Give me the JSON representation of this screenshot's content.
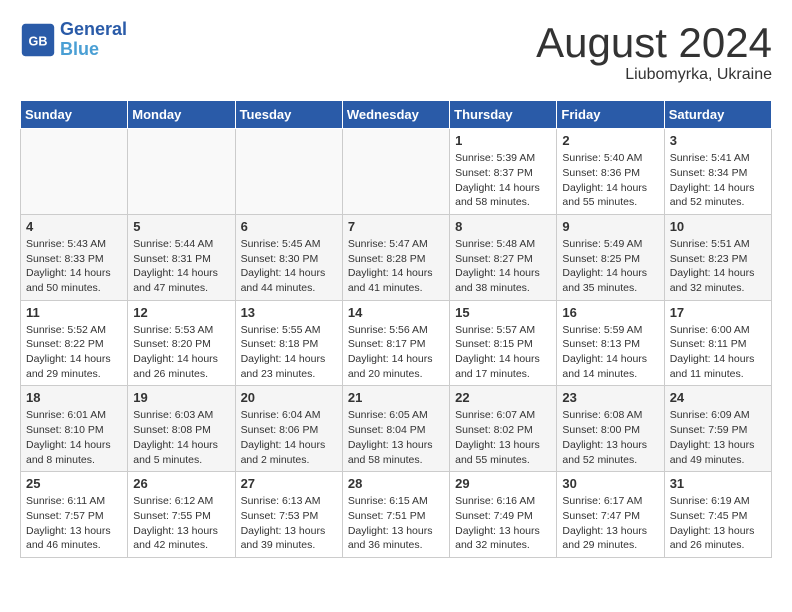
{
  "header": {
    "logo_line1": "General",
    "logo_line2": "Blue",
    "month": "August 2024",
    "location": "Liubomyrka, Ukraine"
  },
  "weekdays": [
    "Sunday",
    "Monday",
    "Tuesday",
    "Wednesday",
    "Thursday",
    "Friday",
    "Saturday"
  ],
  "weeks": [
    [
      {
        "day": "",
        "info": ""
      },
      {
        "day": "",
        "info": ""
      },
      {
        "day": "",
        "info": ""
      },
      {
        "day": "",
        "info": ""
      },
      {
        "day": "1",
        "info": "Sunrise: 5:39 AM\nSunset: 8:37 PM\nDaylight: 14 hours\nand 58 minutes."
      },
      {
        "day": "2",
        "info": "Sunrise: 5:40 AM\nSunset: 8:36 PM\nDaylight: 14 hours\nand 55 minutes."
      },
      {
        "day": "3",
        "info": "Sunrise: 5:41 AM\nSunset: 8:34 PM\nDaylight: 14 hours\nand 52 minutes."
      }
    ],
    [
      {
        "day": "4",
        "info": "Sunrise: 5:43 AM\nSunset: 8:33 PM\nDaylight: 14 hours\nand 50 minutes."
      },
      {
        "day": "5",
        "info": "Sunrise: 5:44 AM\nSunset: 8:31 PM\nDaylight: 14 hours\nand 47 minutes."
      },
      {
        "day": "6",
        "info": "Sunrise: 5:45 AM\nSunset: 8:30 PM\nDaylight: 14 hours\nand 44 minutes."
      },
      {
        "day": "7",
        "info": "Sunrise: 5:47 AM\nSunset: 8:28 PM\nDaylight: 14 hours\nand 41 minutes."
      },
      {
        "day": "8",
        "info": "Sunrise: 5:48 AM\nSunset: 8:27 PM\nDaylight: 14 hours\nand 38 minutes."
      },
      {
        "day": "9",
        "info": "Sunrise: 5:49 AM\nSunset: 8:25 PM\nDaylight: 14 hours\nand 35 minutes."
      },
      {
        "day": "10",
        "info": "Sunrise: 5:51 AM\nSunset: 8:23 PM\nDaylight: 14 hours\nand 32 minutes."
      }
    ],
    [
      {
        "day": "11",
        "info": "Sunrise: 5:52 AM\nSunset: 8:22 PM\nDaylight: 14 hours\nand 29 minutes."
      },
      {
        "day": "12",
        "info": "Sunrise: 5:53 AM\nSunset: 8:20 PM\nDaylight: 14 hours\nand 26 minutes."
      },
      {
        "day": "13",
        "info": "Sunrise: 5:55 AM\nSunset: 8:18 PM\nDaylight: 14 hours\nand 23 minutes."
      },
      {
        "day": "14",
        "info": "Sunrise: 5:56 AM\nSunset: 8:17 PM\nDaylight: 14 hours\nand 20 minutes."
      },
      {
        "day": "15",
        "info": "Sunrise: 5:57 AM\nSunset: 8:15 PM\nDaylight: 14 hours\nand 17 minutes."
      },
      {
        "day": "16",
        "info": "Sunrise: 5:59 AM\nSunset: 8:13 PM\nDaylight: 14 hours\nand 14 minutes."
      },
      {
        "day": "17",
        "info": "Sunrise: 6:00 AM\nSunset: 8:11 PM\nDaylight: 14 hours\nand 11 minutes."
      }
    ],
    [
      {
        "day": "18",
        "info": "Sunrise: 6:01 AM\nSunset: 8:10 PM\nDaylight: 14 hours\nand 8 minutes."
      },
      {
        "day": "19",
        "info": "Sunrise: 6:03 AM\nSunset: 8:08 PM\nDaylight: 14 hours\nand 5 minutes."
      },
      {
        "day": "20",
        "info": "Sunrise: 6:04 AM\nSunset: 8:06 PM\nDaylight: 14 hours\nand 2 minutes."
      },
      {
        "day": "21",
        "info": "Sunrise: 6:05 AM\nSunset: 8:04 PM\nDaylight: 13 hours\nand 58 minutes."
      },
      {
        "day": "22",
        "info": "Sunrise: 6:07 AM\nSunset: 8:02 PM\nDaylight: 13 hours\nand 55 minutes."
      },
      {
        "day": "23",
        "info": "Sunrise: 6:08 AM\nSunset: 8:00 PM\nDaylight: 13 hours\nand 52 minutes."
      },
      {
        "day": "24",
        "info": "Sunrise: 6:09 AM\nSunset: 7:59 PM\nDaylight: 13 hours\nand 49 minutes."
      }
    ],
    [
      {
        "day": "25",
        "info": "Sunrise: 6:11 AM\nSunset: 7:57 PM\nDaylight: 13 hours\nand 46 minutes."
      },
      {
        "day": "26",
        "info": "Sunrise: 6:12 AM\nSunset: 7:55 PM\nDaylight: 13 hours\nand 42 minutes."
      },
      {
        "day": "27",
        "info": "Sunrise: 6:13 AM\nSunset: 7:53 PM\nDaylight: 13 hours\nand 39 minutes."
      },
      {
        "day": "28",
        "info": "Sunrise: 6:15 AM\nSunset: 7:51 PM\nDaylight: 13 hours\nand 36 minutes."
      },
      {
        "day": "29",
        "info": "Sunrise: 6:16 AM\nSunset: 7:49 PM\nDaylight: 13 hours\nand 32 minutes."
      },
      {
        "day": "30",
        "info": "Sunrise: 6:17 AM\nSunset: 7:47 PM\nDaylight: 13 hours\nand 29 minutes."
      },
      {
        "day": "31",
        "info": "Sunrise: 6:19 AM\nSunset: 7:45 PM\nDaylight: 13 hours\nand 26 minutes."
      }
    ]
  ]
}
